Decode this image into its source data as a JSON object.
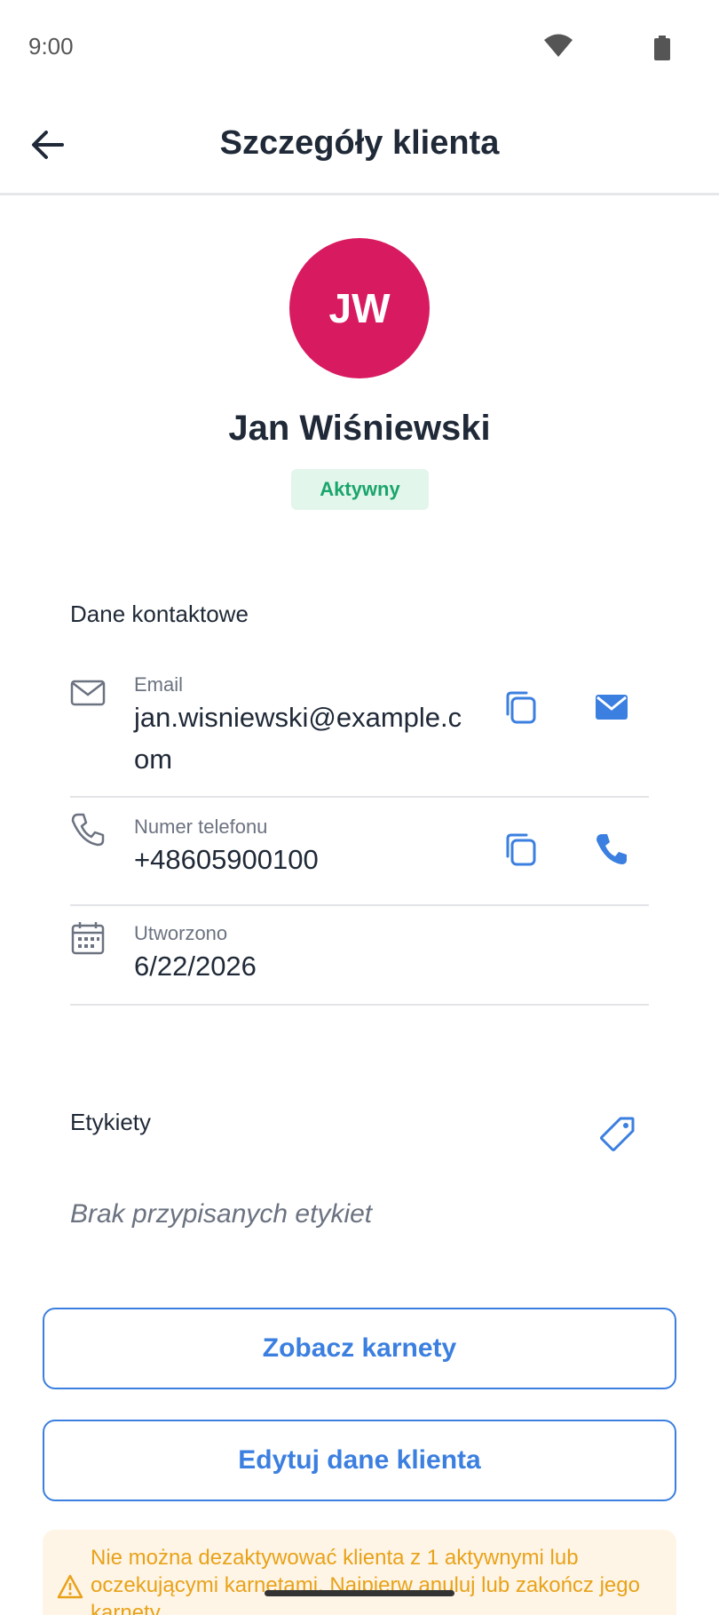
{
  "status_bar": {
    "time": "9:00",
    "wifi_icon": "wifi-icon",
    "battery_icon": "battery-icon"
  },
  "app_bar": {
    "title": "Szczegóły klienta",
    "back_icon": "arrow-back-icon"
  },
  "profile": {
    "initials": "JW",
    "name": "Jan Wiśniewski",
    "status": "Aktywny",
    "avatar_color": "#d81b60",
    "status_color": "#1aa56b"
  },
  "contact": {
    "section_title": "Dane kontaktowe",
    "email": {
      "label": "Email",
      "value": "jan.wisniewski@example.com"
    },
    "phone": {
      "label": "Numer telefonu",
      "value": "+48605900100"
    },
    "created": {
      "label": "Utworzono",
      "value": "6/22/2026"
    }
  },
  "tags": {
    "section_title": "Etykiety",
    "empty_text": "Brak przypisanych etykiet"
  },
  "actions": {
    "view_passes": "Zobacz karnety",
    "edit_client": "Edytuj dane klienta"
  },
  "warning": {
    "text": "Nie można dezaktywować klienta z 1 aktywnymi lub oczekującymi karnetami. Najpierw anuluj lub zakończ jego karnety."
  },
  "colors": {
    "accent": "#3b7fe0",
    "warning": "#e8a21a",
    "warning_bg": "#fff5e6"
  }
}
